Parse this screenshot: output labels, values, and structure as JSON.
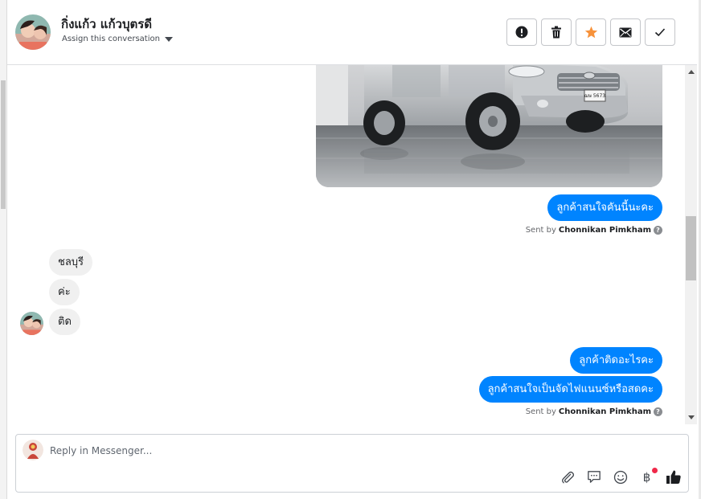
{
  "header": {
    "contact_name": "กิ่งแก้ว แก้วบุตรดี",
    "assign_label": "Assign this conversation",
    "actions": [
      {
        "name": "spam-button",
        "icon": "exclamation-circle-icon"
      },
      {
        "name": "delete-button",
        "icon": "trash-icon"
      },
      {
        "name": "star-button",
        "icon": "star-icon",
        "color": "#f7923b"
      },
      {
        "name": "mark-unread-button",
        "icon": "envelope-icon"
      },
      {
        "name": "mark-done-button",
        "icon": "check-icon"
      }
    ]
  },
  "conversation": {
    "messages_out_1": [
      "ลูกค้าสนใจคันนี้นะคะ"
    ],
    "sent_by_1": {
      "prefix": "Sent by",
      "name": "Chonnikan Pimkham"
    },
    "messages_in": [
      "ชลบุรี",
      "ค่ะ",
      "ติด"
    ],
    "messages_out_2": [
      "ลูกค้าติดอะไรคะ",
      "ลูกค้าสนใจเป็นจัดไฟแนนซ์หรือสดคะ"
    ],
    "sent_by_2": {
      "prefix": "Sent by",
      "name": "Chonnikan Pimkham"
    },
    "photo_plate": "ฌษ 5673"
  },
  "composer": {
    "placeholder": "Reply in Messenger...",
    "tools": [
      "attachment-icon",
      "saved-reply-icon",
      "emoji-icon",
      "payment-icon",
      "like-icon"
    ],
    "payment_symbol": "฿"
  },
  "colors": {
    "outgoing_bubble": "#0084ff",
    "incoming_bubble": "#f0f0f0",
    "star": "#f7923b",
    "notification": "#f02849"
  }
}
